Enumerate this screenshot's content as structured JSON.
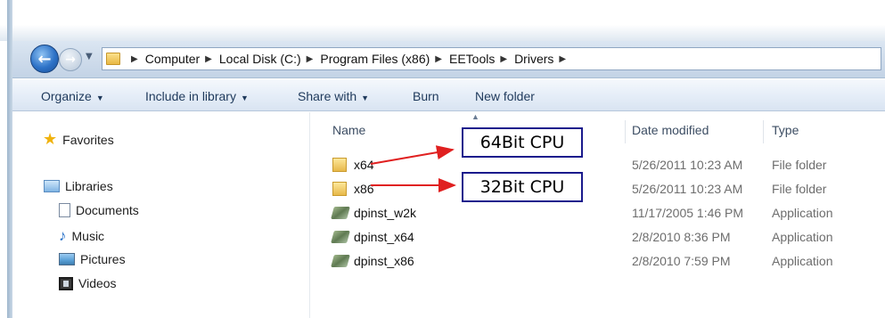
{
  "address_bar": {
    "breadcrumbs": [
      "Computer",
      "Local Disk (C:)",
      "Program Files (x86)",
      "EETools",
      "Drivers"
    ]
  },
  "toolbar": {
    "organize": "Organize",
    "include_in_library": "Include in library",
    "share_with": "Share with",
    "burn": "Burn",
    "new_folder": "New folder"
  },
  "nav_pane": {
    "favorites": "Favorites",
    "libraries": "Libraries",
    "items": [
      {
        "label": "Documents",
        "icon": "documents-icon"
      },
      {
        "label": "Music",
        "icon": "music-icon"
      },
      {
        "label": "Pictures",
        "icon": "pictures-icon"
      },
      {
        "label": "Videos",
        "icon": "videos-icon"
      }
    ]
  },
  "columns": {
    "name": "Name",
    "date_modified": "Date modified",
    "type": "Type"
  },
  "files": [
    {
      "name": "x64",
      "date": "5/26/2011 10:23 AM",
      "type": "File folder",
      "icon": "folder-icon"
    },
    {
      "name": "x86",
      "date": "5/26/2011 10:23 AM",
      "type": "File folder",
      "icon": "folder-icon"
    },
    {
      "name": "dpinst_w2k",
      "date": "11/17/2005 1:46 PM",
      "type": "Application",
      "icon": "application-icon"
    },
    {
      "name": "dpinst_x64",
      "date": "2/8/2010 8:36 PM",
      "type": "Application",
      "icon": "application-icon"
    },
    {
      "name": "dpinst_x86",
      "date": "2/8/2010 7:59 PM",
      "type": "Application",
      "icon": "application-icon"
    }
  ],
  "annotations": {
    "label_64": "64Bit CPU",
    "label_32": "32Bit CPU",
    "arrow_color": "#e02020",
    "box_color": "#1a1a8c"
  }
}
